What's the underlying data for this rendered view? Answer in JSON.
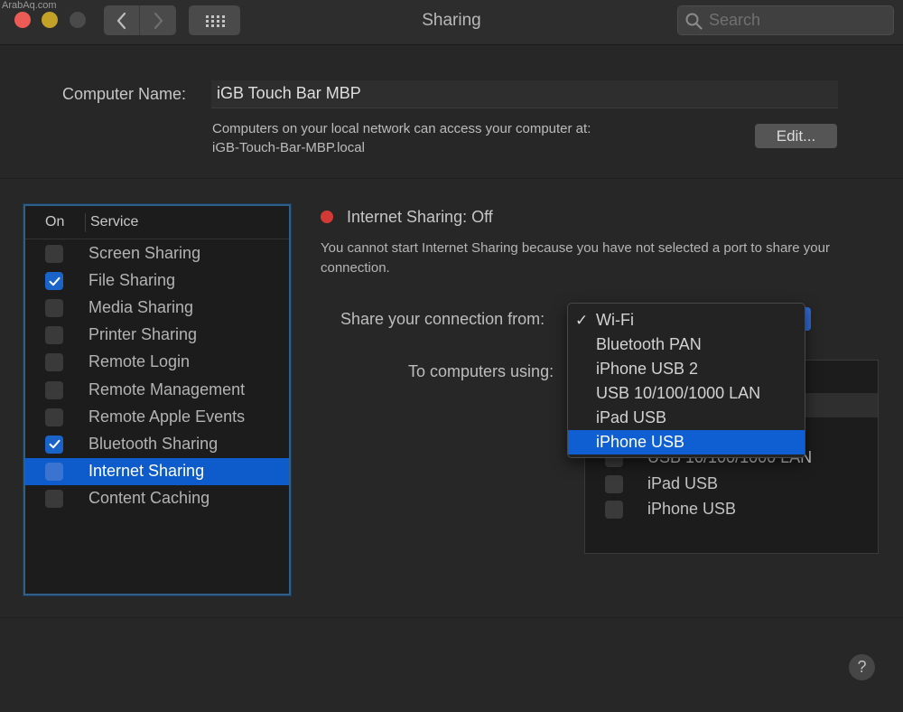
{
  "watermark": "ArabAq.com",
  "window": {
    "title": "Sharing"
  },
  "search": {
    "placeholder": "Search"
  },
  "computer_name": {
    "label": "Computer Name:",
    "value": "iGB Touch Bar MBP",
    "description_line1": "Computers on your local network can access your computer at:",
    "description_line2": "iGB-Touch-Bar-MBP.local",
    "edit_label": "Edit..."
  },
  "services": {
    "header_on": "On",
    "header_service": "Service",
    "items": [
      {
        "label": "Screen Sharing",
        "checked": false
      },
      {
        "label": "File Sharing",
        "checked": true
      },
      {
        "label": "Media Sharing",
        "checked": false
      },
      {
        "label": "Printer Sharing",
        "checked": false
      },
      {
        "label": "Remote Login",
        "checked": false
      },
      {
        "label": "Remote Management",
        "checked": false
      },
      {
        "label": "Remote Apple Events",
        "checked": false
      },
      {
        "label": "Bluetooth Sharing",
        "checked": true
      },
      {
        "label": "Internet Sharing",
        "checked": false,
        "selected": true
      },
      {
        "label": "Content Caching",
        "checked": false
      }
    ]
  },
  "internet_sharing": {
    "status": "Internet Sharing: Off",
    "status_color": "#d43a35",
    "info": "You cannot start Internet Sharing because you have not selected a port to share your connection.",
    "share_from_label": "Share your connection from:",
    "to_computers_label": "To computers using:",
    "ports_visible": [
      {
        "label": "USB 10/100/1000 LAN",
        "checked": false
      },
      {
        "label": "iPad USB",
        "checked": false
      },
      {
        "label": "iPhone USB",
        "checked": false
      }
    ]
  },
  "dropdown": {
    "check_glyph": "✓",
    "options": [
      {
        "label": "Wi-Fi",
        "checked": true,
        "highlighted": false
      },
      {
        "label": "Bluetooth PAN",
        "checked": false,
        "highlighted": false
      },
      {
        "label": "iPhone USB 2",
        "checked": false,
        "highlighted": false
      },
      {
        "label": "USB 10/100/1000 LAN",
        "checked": false,
        "highlighted": false
      },
      {
        "label": "iPad USB",
        "checked": false,
        "highlighted": false
      },
      {
        "label": "iPhone USB",
        "checked": false,
        "highlighted": true
      }
    ]
  },
  "help": {
    "label": "?"
  },
  "colors": {
    "accent": "#0e5ccb",
    "background": "#272727",
    "list_focus": "#2f5e86"
  }
}
